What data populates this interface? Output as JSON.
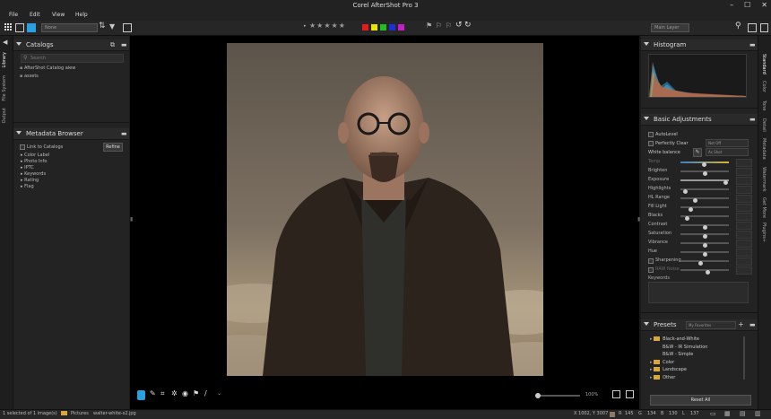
{
  "app": {
    "title": "Corel AfterShot Pro 3"
  },
  "menu": [
    "File",
    "Edit",
    "View",
    "Help"
  ],
  "toolbar": {
    "filter_select": "None",
    "layer_select": "Main Layer",
    "stars": [
      "★",
      "★",
      "★",
      "★",
      "★"
    ],
    "color_labels": [
      "#e31b1b",
      "#e6e600",
      "#1ec11e",
      "#1f2fd8",
      "#c61ec6"
    ]
  },
  "left_tabs": [
    "Library",
    "File System",
    "Output"
  ],
  "catalogs": {
    "title": "Catalogs",
    "search_placeholder": "Search",
    "items": [
      "AfterShot Catalog aiew",
      "assets"
    ]
  },
  "metadata": {
    "title": "Metadata Browser",
    "link_label": "Link to Catalogs",
    "refine_label": "Refine",
    "items": [
      "Color Label",
      "Photo Info",
      "IPTC",
      "Keywords",
      "Rating",
      "Flag"
    ]
  },
  "right_tabs": [
    "Standard",
    "Color",
    "Tone",
    "Detail",
    "Metadata",
    "Watermark",
    "Get More",
    "Plugins+"
  ],
  "histogram": {
    "title": "Histogram"
  },
  "adjustments": {
    "title": "Basic Adjustments",
    "autolevel": "AutoLevel",
    "perfectly_clear": "Perfectly Clear",
    "perfectly_clear_value": "Not Off",
    "white_balance": "White balance",
    "white_balance_value": "As Shot",
    "sliders": [
      {
        "name": "Temp",
        "level": 0.48,
        "dim": true
      },
      {
        "name": "Brighten",
        "level": 0.5
      },
      {
        "name": "Exposure",
        "level": 0.95
      },
      {
        "name": "Highlights",
        "level": 0.05
      },
      {
        "name": "HL Range",
        "level": 0.28
      },
      {
        "name": "Fill Light",
        "level": 0.18
      },
      {
        "name": "Blacks",
        "level": 0.1
      },
      {
        "name": "Contrast",
        "level": 0.5
      },
      {
        "name": "Saturation",
        "level": 0.5
      },
      {
        "name": "Vibrance",
        "level": 0.5
      },
      {
        "name": "Hue",
        "level": 0.5
      },
      {
        "name": "Sharpening",
        "level": 0.4
      },
      {
        "name": "RAW Noise",
        "level": 0.55,
        "dim": true
      }
    ],
    "keywords": "Keywords"
  },
  "presets": {
    "title": "Presets",
    "select": "My Favorites",
    "items": [
      {
        "label": "Black-and-White",
        "folder": true,
        "indent": 0
      },
      {
        "label": "B&W - IR Simulation",
        "folder": false,
        "indent": 1
      },
      {
        "label": "B&W - Simple",
        "folder": false,
        "indent": 1
      },
      {
        "label": "Color",
        "folder": true,
        "indent": 0
      },
      {
        "label": "Landscape",
        "folder": true,
        "indent": 0
      },
      {
        "label": "Other",
        "folder": true,
        "indent": 0
      }
    ],
    "reset_label": "Reset All"
  },
  "bottom": {
    "zoom": "100%"
  },
  "status": {
    "selection": "1 selected of 1 image(s)",
    "folder": "Pictures",
    "filename": "walter-white-s2.jpg",
    "coords": "X 1002, Y 3007",
    "r_label": "R",
    "r_value": "145",
    "g_label": "G",
    "g_value": "134",
    "b_label": "B",
    "b_value": "130",
    "l_label": "L",
    "l_value": "137"
  }
}
